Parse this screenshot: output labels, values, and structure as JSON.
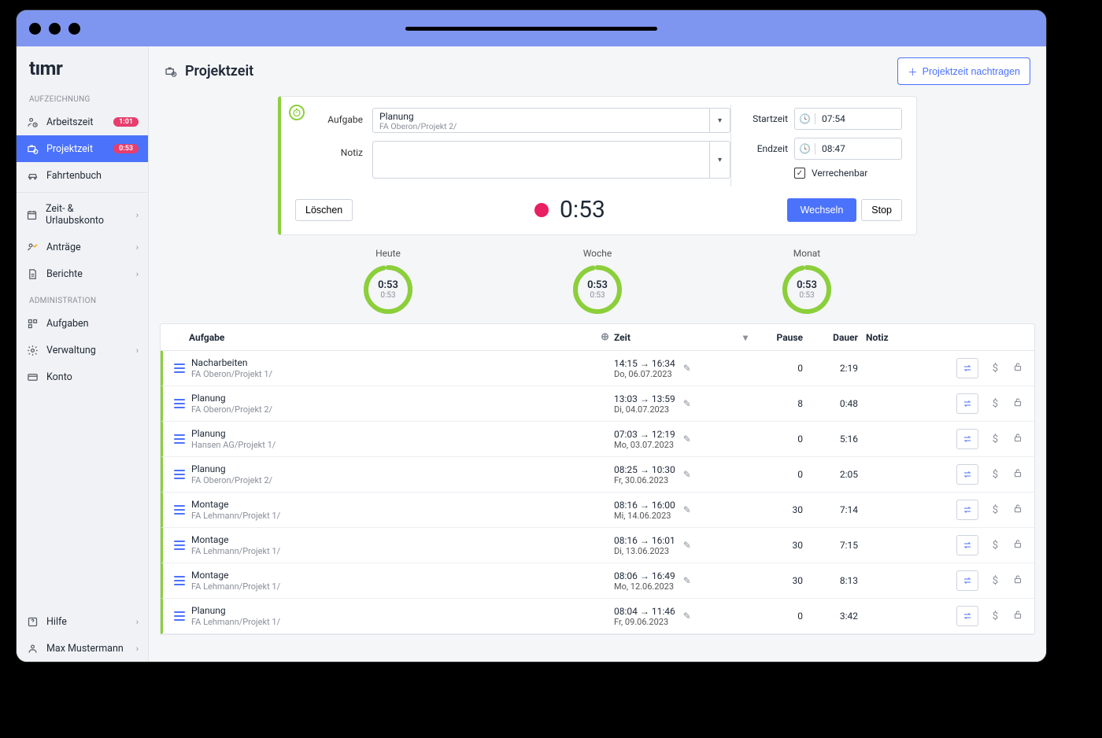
{
  "app": {
    "logo": "tımr"
  },
  "sidebar": {
    "section1": "AUFZEICHNUNG",
    "section2": "ADMINISTRATION",
    "items": {
      "arbeitszeit": {
        "label": "Arbeitszeit",
        "badge": "1:01"
      },
      "projektzeit": {
        "label": "Projektzeit",
        "badge": "0:53"
      },
      "fahrtenbuch": {
        "label": "Fahrtenbuch"
      },
      "zeitkonto": {
        "label": "Zeit- & Urlaubskonto"
      },
      "antraege": {
        "label": "Anträge"
      },
      "berichte": {
        "label": "Berichte"
      },
      "aufgaben": {
        "label": "Aufgaben"
      },
      "verwaltung": {
        "label": "Verwaltung"
      },
      "konto": {
        "label": "Konto"
      },
      "hilfe": {
        "label": "Hilfe"
      },
      "user": {
        "label": "Max Mustermann"
      }
    }
  },
  "header": {
    "title": "Projektzeit",
    "button": "Projektzeit nachtragen"
  },
  "tracker": {
    "aufgabe_label": "Aufgabe",
    "notiz_label": "Notiz",
    "task_title": "Planung",
    "task_path": "FA Oberon/Projekt 2/",
    "startzeit_label": "Startzeit",
    "endzeit_label": "Endzeit",
    "startzeit": "07:54",
    "endzeit": "08:47",
    "verrechenbar": "Verrechenbar",
    "delete": "Löschen",
    "timer": "0:53",
    "wechseln": "Wechseln",
    "stop": "Stop"
  },
  "summaries": {
    "heute": {
      "label": "Heute",
      "big": "0:53",
      "small": "0:53"
    },
    "woche": {
      "label": "Woche",
      "big": "0:53",
      "small": "0:53"
    },
    "monat": {
      "label": "Monat",
      "big": "0:53",
      "small": "0:53"
    }
  },
  "table": {
    "headers": {
      "aufgabe": "Aufgabe",
      "zeit": "Zeit",
      "pause": "Pause",
      "dauer": "Dauer",
      "notiz": "Notiz"
    },
    "rows": [
      {
        "title": "Nacharbeiten",
        "path": "FA Oberon/Projekt 1/",
        "time": "14:15 → 16:34",
        "date": "Do, 06.07.2023",
        "pause": "0",
        "dauer": "2:19"
      },
      {
        "title": "Planung",
        "path": "FA Oberon/Projekt 2/",
        "time": "13:03 → 13:59",
        "date": "Di, 04.07.2023",
        "pause": "8",
        "dauer": "0:48"
      },
      {
        "title": "Planung",
        "path": "Hansen AG/Projekt 1/",
        "time": "07:03 → 12:19",
        "date": "Mo, 03.07.2023",
        "pause": "0",
        "dauer": "5:16"
      },
      {
        "title": "Planung",
        "path": "FA Oberon/Projekt 2/",
        "time": "08:25 → 10:30",
        "date": "Fr, 30.06.2023",
        "pause": "0",
        "dauer": "2:05"
      },
      {
        "title": "Montage",
        "path": "FA Lehmann/Projekt 1/",
        "time": "08:16 → 16:00",
        "date": "Mi, 14.06.2023",
        "pause": "30",
        "dauer": "7:14"
      },
      {
        "title": "Montage",
        "path": "FA Lehmann/Projekt 1/",
        "time": "08:16 → 16:01",
        "date": "Di, 13.06.2023",
        "pause": "30",
        "dauer": "7:15"
      },
      {
        "title": "Montage",
        "path": "FA Lehmann/Projekt 1/",
        "time": "08:06 → 16:49",
        "date": "Mo, 12.06.2023",
        "pause": "30",
        "dauer": "8:13"
      },
      {
        "title": "Planung",
        "path": "FA Lehmann/Projekt 1/",
        "time": "08:04 → 11:46",
        "date": "Fr, 09.06.2023",
        "pause": "0",
        "dauer": "3:42"
      }
    ]
  }
}
